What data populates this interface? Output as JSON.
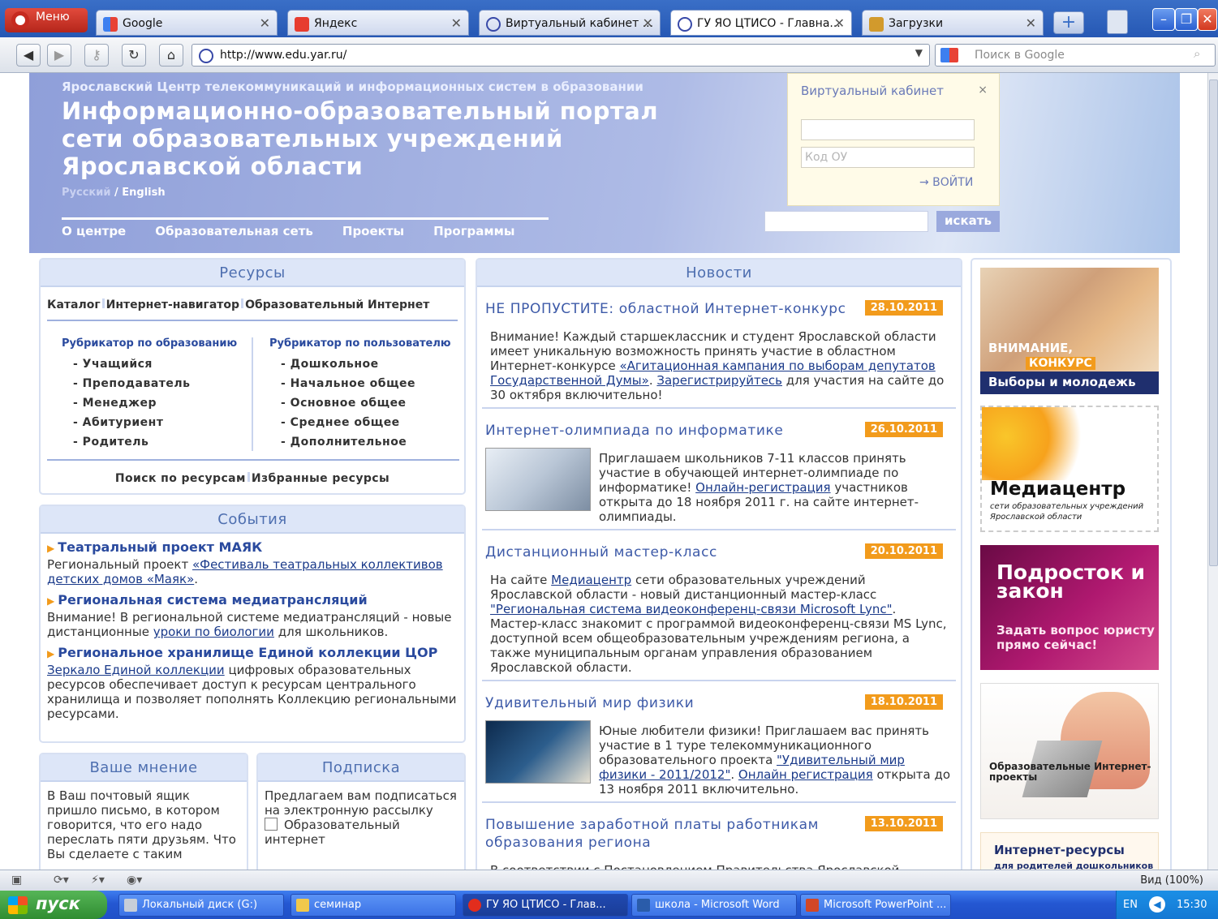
{
  "browser": {
    "menu_label": "Меню",
    "tabs": [
      {
        "label": "Google"
      },
      {
        "label": "Яндекс"
      },
      {
        "label": "Виртуальный кабинет ..."
      },
      {
        "label": "ГУ ЯО ЦТИСО - Главна..."
      },
      {
        "label": "Загрузки"
      }
    ],
    "url": "http://www.edu.yar.ru/",
    "search_placeholder": "Поиск в Google",
    "zoom_label": "Вид (100%)"
  },
  "header": {
    "org": "Ярославский Центр телекоммуникаций и информационных систем в образовании",
    "title": "Информационно-образовательный портал сети образовательных учреждений Ярославской области",
    "lang_ru": "Русский",
    "lang_sep": " / ",
    "lang_en": "English",
    "nav": [
      "О центре",
      "Образовательная сеть",
      "Проекты",
      "Программы"
    ],
    "search_button": "искать"
  },
  "vk": {
    "title": "Виртуальный кабинет",
    "close": "×",
    "code_placeholder": "Код ОУ",
    "login_label": "→ ВОЙТИ"
  },
  "resources": {
    "title": "Ресурсы",
    "tabs": [
      "Каталог",
      "Интернет-навигатор",
      "Образовательный Интернет"
    ],
    "rub1": {
      "title": "Рубрикатор по образованию",
      "items": [
        "- Учащийся",
        "- Преподаватель",
        "- Менеджер",
        "- Абитуриент",
        "- Родитель"
      ]
    },
    "rub2": {
      "title": "Рубрикатор по пользователю",
      "items": [
        "- Дошкольное",
        "- Начальное общее",
        "- Основное общее",
        "- Среднее общее",
        "- Дополнительное"
      ]
    },
    "footer": [
      "Поиск по ресурсам",
      "Избранные ресурсы"
    ]
  },
  "events": {
    "title": "События",
    "items": [
      {
        "title": "Театральный проект МАЯК",
        "pre": "Региональный проект ",
        "link": "«Фестиваль театральных коллективов детских домов «Маяк»",
        "post": "."
      },
      {
        "title": "Региональная система медиатрансляций",
        "pre": "Внимание! В региональной системе медиатрансляций - новые дистанционные ",
        "link": "уроки по биологии",
        "post": " для школьников."
      },
      {
        "title": "Региональное хранилище Единой коллекции ЦОР",
        "pre": "",
        "link": "Зеркало Единой коллекции",
        "post": " цифровых образовательных ресурсов обеспечивает доступ к ресурсам центрального хранилища и позволяет пополнять Коллекцию региональными ресурсами."
      }
    ]
  },
  "opinion": {
    "title": "Ваше мнение",
    "text": "В Ваш почтовый ящик пришло письмо, в котором говорится, что его надо переслать пяти друзьям. Что Вы сделаете с таким"
  },
  "subscribe": {
    "title": "Подписка",
    "text": "Предлагаем вам подписаться на электронную рассылку",
    "option": "Образовательный интернет"
  },
  "news": {
    "title": "Новости",
    "items": [
      {
        "title": "НЕ ПРОПУСТИТЕ: областной Интернет-конкурс",
        "date": "28.10.2011",
        "t1": "Внимание! Каждый старшеклассник и студент Ярославской области имеет уникальную возможность принять участие в областном Интернет-конкурсе ",
        "l1": "«Агитационная кампания по выборам депутатов Государственной Думы»",
        "t2": ". ",
        "l2": "Зарегистрируйтесь",
        "t3": " для участия на сайте до 30 октября включительно!"
      },
      {
        "title": "Интернет-олимпиада по информатике",
        "date": "26.10.2011",
        "t1": "Приглашаем школьников 7-11 классов принять участие в обучающей интернет-олимпиаде по информатике! ",
        "l1": "Онлайн-регистрация",
        "t2": " участников открыта до 18 ноября 2011 г. на сайте интернет-олимпиады."
      },
      {
        "title": "Дистанционный мастер-класс",
        "date": "20.10.2011",
        "t1": "На сайте ",
        "l1": "Медиацентр",
        "t2": " сети образовательных учреждений Ярославской области - новый дистанционный мастер-класс ",
        "l2": "\"Региональная система видеоконференц-связи Microsoft Lync\"",
        "t3": ". Мастер-класс знакомит с программой видеоконференц-связи MS Lync, доступной всем общеобразовательным учреждениям региона, а также муниципальным органам управления образованием Ярославской области."
      },
      {
        "title": "Удивительный мир физики",
        "date": "18.10.2011",
        "t1": "Юные любители физики! Приглашаем вас принять участие в 1 туре телекоммуникационного образовательного проекта ",
        "l1": "\"Удивительный мир физики - 2011/2012\"",
        "t2": ". ",
        "l2": "Онлайн регистрация",
        "t3": " открыта до 13 ноября 2011 включительно."
      },
      {
        "title": "Повышение заработной платы работникам образования региона",
        "date": "13.10.2011",
        "t1": "В соответствии с Постановлением Правительства Ярославской"
      }
    ]
  },
  "banners": {
    "b1": {
      "l1": "ВНИМАНИЕ,",
      "l2": "КОНКУРС",
      "l3": "Выборы и молодежь"
    },
    "b2": {
      "l1": "Медиацентр",
      "l2": "сети образовательных учреждений Ярославской области"
    },
    "b3": {
      "l1": "Подросток и закон",
      "l2": "Задать вопрос юристу прямо сейчас!"
    },
    "b4": {
      "l1": "Образовательные Интернет-проекты"
    },
    "b5": {
      "l1": "Интернет-ресурсы",
      "l2": "для родителей дошкольников"
    }
  },
  "taskbar": {
    "start": "пуск",
    "items": [
      "Локальный диск (G:)",
      "семинар",
      "ГУ ЯО ЦТИСО - Глав...",
      "школа - Microsoft Word",
      "Microsoft PowerPoint ..."
    ],
    "lang": "EN",
    "clock": "15:30"
  }
}
